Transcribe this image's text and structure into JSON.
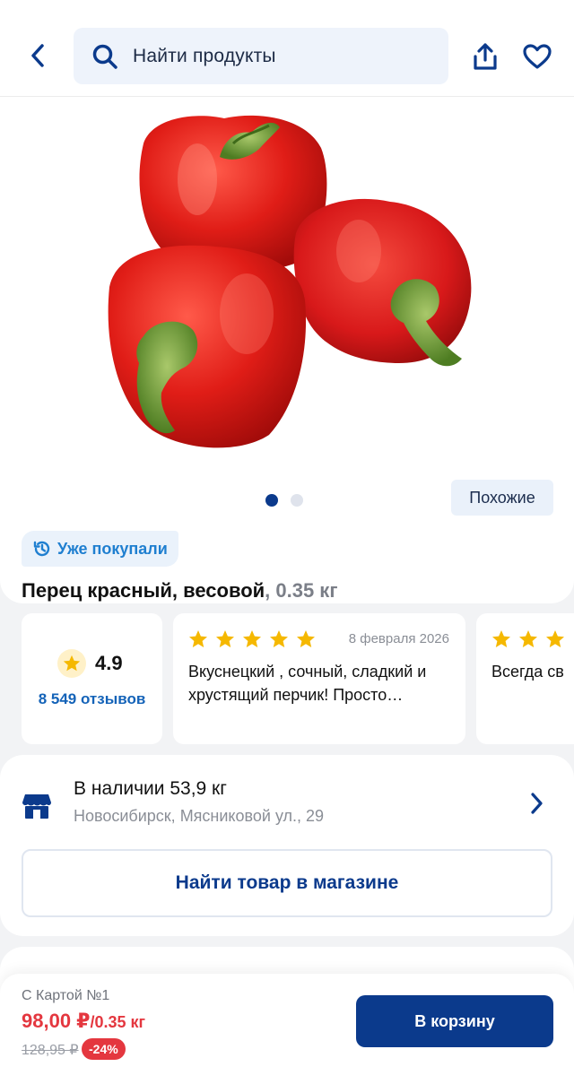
{
  "header": {
    "search_placeholder": "Найти продукты"
  },
  "icons": {
    "back": "chevron-left-icon",
    "search": "search-icon",
    "share": "share-icon",
    "favorite": "heart-icon",
    "history": "history-icon",
    "star": "star-icon",
    "store": "store-icon",
    "chevron": "chevron-right-icon"
  },
  "product": {
    "similar_label": "Похожие",
    "bought_label": "Уже покупали",
    "name": "Перец красный, весовой",
    "weight": ", 0.35 кг",
    "gallery_pages": 2,
    "gallery_active": 1
  },
  "reviews": {
    "rating": "4.9",
    "count": "8 549 отзывов",
    "items": [
      {
        "stars": 5,
        "date": "8 февраля 2026",
        "text": "Вкуснецкий , сочный, сладкий и хрустящий перчик! Просто…"
      },
      {
        "stars": 3,
        "date": "",
        "text": "Всегда св"
      }
    ]
  },
  "stock": {
    "title": "В наличии 53,9 кг",
    "address": "Новосибирск, Мясниковой ул., 29",
    "find_button": "Найти товар в магазине"
  },
  "purchase": {
    "card_label": "С Картой №1",
    "price": "98,00 ₽",
    "unit": "/0.35 кг",
    "old_price": "128,95 ₽",
    "discount": "-24%",
    "cart_button": "В корзину"
  },
  "colors": {
    "brand_blue": "#0b3a8c",
    "price_red": "#e4373f",
    "star_yellow": "#f5b800",
    "link_blue": "#1463b8"
  }
}
